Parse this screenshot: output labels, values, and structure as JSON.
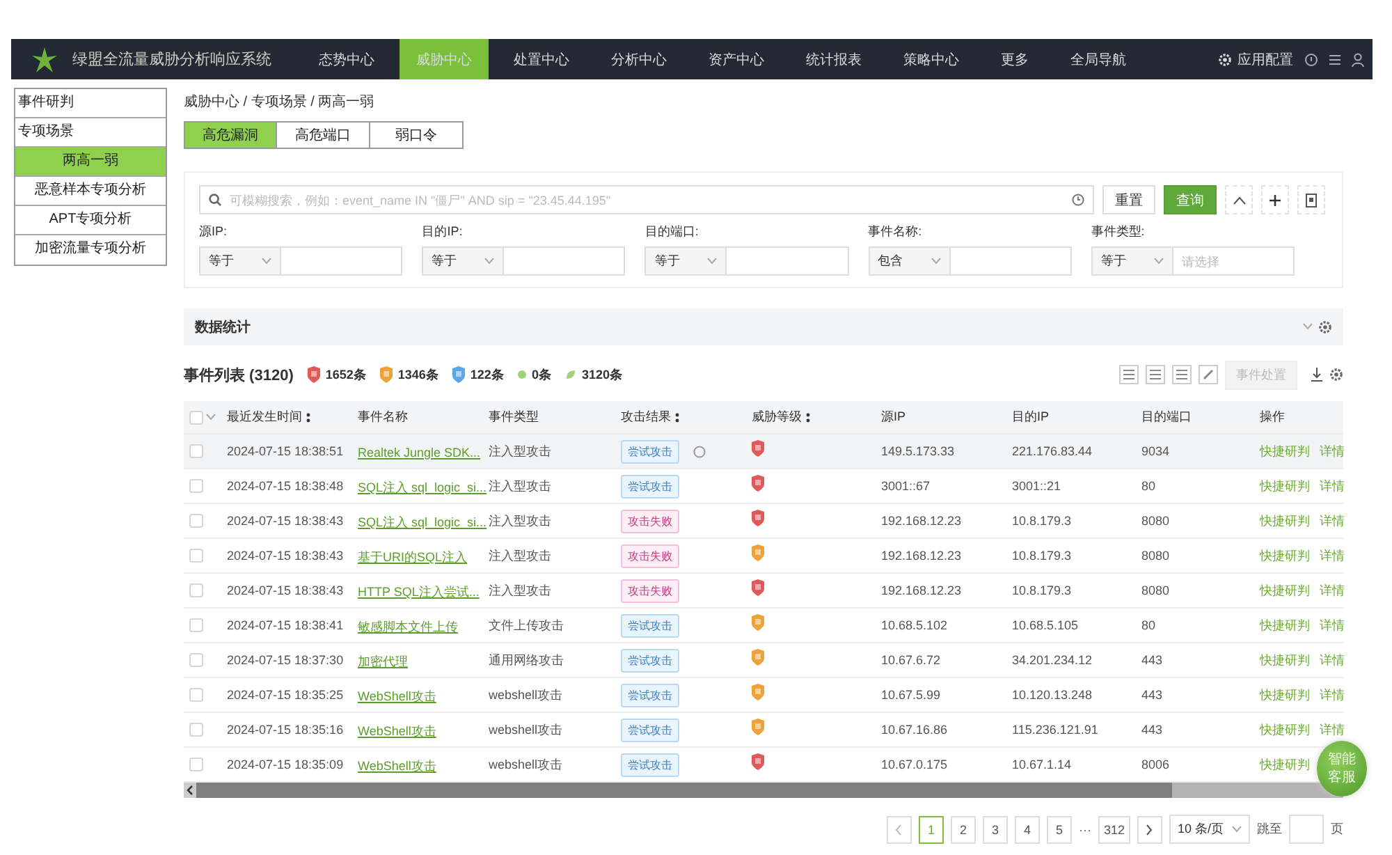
{
  "app": {
    "title": "绿盟全流量威胁分析响应系统",
    "settings": "应用配置"
  },
  "nav": [
    {
      "label": "态势中心",
      "selected": false
    },
    {
      "label": "威胁中心",
      "selected": true
    },
    {
      "label": "处置中心",
      "selected": false
    },
    {
      "label": "分析中心",
      "selected": false
    },
    {
      "label": "资产中心",
      "selected": false
    },
    {
      "label": "统计报表",
      "selected": false
    },
    {
      "label": "策略中心",
      "selected": false
    },
    {
      "label": "更多",
      "selected": false
    },
    {
      "label": "全局导航",
      "selected": false
    }
  ],
  "sidebar": [
    {
      "label": "事件研判",
      "kind": "group",
      "selected": false
    },
    {
      "label": "专项场景",
      "kind": "group",
      "selected": false
    },
    {
      "label": "两高一弱",
      "kind": "item",
      "selected": true
    },
    {
      "label": "恶意样本专项分析",
      "kind": "item",
      "selected": false
    },
    {
      "label": "APT专项分析",
      "kind": "item",
      "selected": false
    },
    {
      "label": "加密流量专项分析",
      "kind": "item",
      "selected": false
    }
  ],
  "breadcrumb": "威胁中心 / 专项场景 / 两高一弱",
  "tabs": [
    {
      "label": "高危漏洞",
      "selected": true
    },
    {
      "label": "高危端口",
      "selected": false
    },
    {
      "label": "弱口令",
      "selected": false
    }
  ],
  "search": {
    "placeholder": "可模糊搜索，例如：event_name IN \"僵尸\" AND sip = \"23.45.44.195\"",
    "reset": "重置",
    "query": "查询"
  },
  "filters": [
    {
      "label": "源IP:",
      "operator": "等于"
    },
    {
      "label": "目的IP:",
      "operator": "等于"
    },
    {
      "label": "目的端口:",
      "operator": "等于"
    },
    {
      "label": "事件名称:",
      "operator": "包含"
    },
    {
      "label": "事件类型:",
      "operator": "等于",
      "placeholder": "请选择"
    }
  ],
  "stats_panel": {
    "title": "数据统计"
  },
  "event_list": {
    "title": "事件列表 (3120)",
    "action_button": "事件处置",
    "counts": [
      {
        "kind": "shield",
        "color": "#e05a5a",
        "text": "1652条"
      },
      {
        "kind": "shield",
        "color": "#f0a23a",
        "text": "1346条"
      },
      {
        "kind": "shield",
        "color": "#5aa8e8",
        "text": "122条"
      },
      {
        "kind": "dot",
        "text": "0条"
      },
      {
        "kind": "leaf",
        "text": "3120条"
      }
    ]
  },
  "table": {
    "select_all_checked": false,
    "columns": [
      {
        "label": "最近发生时间",
        "sortable": true
      },
      {
        "label": "事件名称",
        "sortable": false
      },
      {
        "label": "事件类型",
        "sortable": false
      },
      {
        "label": "攻击结果",
        "sortable": true
      },
      {
        "label": "威胁等级",
        "sortable": true
      },
      {
        "label": "源IP",
        "sortable": false
      },
      {
        "label": "目的IP",
        "sortable": false
      },
      {
        "label": "目的端口",
        "sortable": false
      },
      {
        "label": "操作",
        "sortable": false
      }
    ],
    "rows": [
      {
        "checked": false,
        "time": "2024-07-15 18:38:51",
        "name": "Realtek Jungle SDK...",
        "type": "注入型攻击",
        "result": {
          "kind": "try",
          "label": "尝试攻击"
        },
        "color": "#e05a5a",
        "src": "149.5.173.33",
        "dst": "221.176.83.44",
        "port": "9034",
        "actions": [
          "快捷研判",
          "详情"
        ],
        "highlighted": true
      },
      {
        "checked": false,
        "time": "2024-07-15 18:38:48",
        "name": "SQL注入 sql_logic_si...",
        "type": "注入型攻击",
        "result": {
          "kind": "try",
          "label": "尝试攻击"
        },
        "color": "#e05a5a",
        "src": "3001::67",
        "dst": "3001::21",
        "port": "80",
        "actions": [
          "快捷研判",
          "详情"
        ],
        "highlighted": false
      },
      {
        "checked": false,
        "time": "2024-07-15 18:38:43",
        "name": "SQL注入 sql_logic_si...",
        "type": "注入型攻击",
        "result": {
          "kind": "fail",
          "label": "攻击失败"
        },
        "color": "#e05a5a",
        "src": "192.168.12.23",
        "dst": "10.8.179.3",
        "port": "8080",
        "actions": [
          "快捷研判",
          "详情"
        ],
        "highlighted": false
      },
      {
        "checked": false,
        "time": "2024-07-15 18:38:43",
        "name": "基于URI的SQL注入",
        "type": "注入型攻击",
        "result": {
          "kind": "fail",
          "label": "攻击失败"
        },
        "color": "#f0a23a",
        "src": "192.168.12.23",
        "dst": "10.8.179.3",
        "port": "8080",
        "actions": [
          "快捷研判",
          "详情"
        ],
        "highlighted": false
      },
      {
        "checked": false,
        "time": "2024-07-15 18:38:43",
        "name": "HTTP SQL注入尝试...",
        "type": "注入型攻击",
        "result": {
          "kind": "fail",
          "label": "攻击失败"
        },
        "color": "#e05a5a",
        "src": "192.168.12.23",
        "dst": "10.8.179.3",
        "port": "8080",
        "actions": [
          "快捷研判",
          "详情"
        ],
        "highlighted": false
      },
      {
        "checked": false,
        "time": "2024-07-15 18:38:41",
        "name": "敏感脚本文件上传",
        "type": "文件上传攻击",
        "result": {
          "kind": "try",
          "label": "尝试攻击"
        },
        "color": "#f0a23a",
        "src": "10.68.5.102",
        "dst": "10.68.5.105",
        "port": "80",
        "actions": [
          "快捷研判",
          "详情"
        ],
        "highlighted": false
      },
      {
        "checked": false,
        "time": "2024-07-15 18:37:30",
        "name": "加密代理",
        "type": "通用网络攻击",
        "result": {
          "kind": "try",
          "label": "尝试攻击"
        },
        "color": "#f0a23a",
        "src": "10.67.6.72",
        "dst": "34.201.234.12",
        "port": "443",
        "actions": [
          "快捷研判",
          "详情"
        ],
        "highlighted": false
      },
      {
        "checked": false,
        "time": "2024-07-15 18:35:25",
        "name": "WebShell攻击",
        "type": "webshell攻击",
        "result": {
          "kind": "try",
          "label": "尝试攻击"
        },
        "color": "#f0a23a",
        "src": "10.67.5.99",
        "dst": "10.120.13.248",
        "port": "443",
        "actions": [
          "快捷研判",
          "详情"
        ],
        "highlighted": false
      },
      {
        "checked": false,
        "time": "2024-07-15 18:35:16",
        "name": "WebShell攻击",
        "type": "webshell攻击",
        "result": {
          "kind": "try",
          "label": "尝试攻击"
        },
        "color": "#f0a23a",
        "src": "10.67.16.86",
        "dst": "115.236.121.91",
        "port": "443",
        "actions": [
          "快捷研判",
          "详情"
        ],
        "highlighted": false
      },
      {
        "checked": false,
        "time": "2024-07-15 18:35:09",
        "name": "WebShell攻击",
        "type": "webshell攻击",
        "result": {
          "kind": "try",
          "label": "尝试攻击"
        },
        "color": "#e05a5a",
        "src": "10.67.0.175",
        "dst": "10.67.1.14",
        "port": "8006",
        "actions": [
          "快捷研判"
        ],
        "highlighted": false
      }
    ]
  },
  "pagination": {
    "pages": [
      {
        "label": "1",
        "selected": true
      },
      {
        "label": "2",
        "selected": false
      },
      {
        "label": "3",
        "selected": false
      },
      {
        "label": "4",
        "selected": false
      },
      {
        "label": "5",
        "selected": false
      },
      {
        "label": "312",
        "selected": false
      }
    ],
    "ellipsis": "···",
    "page_size": "10 条/页",
    "jump_label": "跳至",
    "page_suffix": "页"
  },
  "chat_bubble": "智能客服"
}
